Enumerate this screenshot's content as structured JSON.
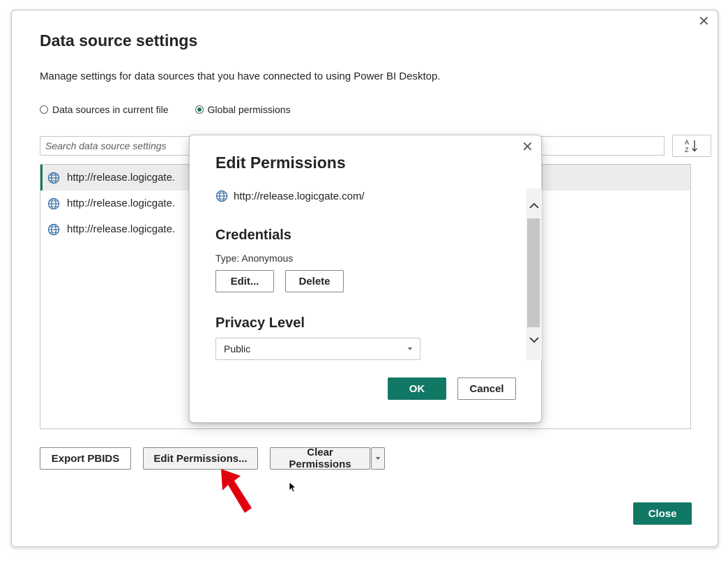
{
  "dialog": {
    "title": "Data source settings",
    "description": "Manage settings for data sources that you have connected to using Power BI Desktop.",
    "radio_options": [
      {
        "label": "Data sources in current file",
        "selected": false
      },
      {
        "label": "Global permissions",
        "selected": true
      }
    ],
    "search_placeholder": "Search data source settings",
    "sources": [
      {
        "url": "http://release.logicgate."
      },
      {
        "url": "http://release.logicgate."
      },
      {
        "url": "http://release.logicgate."
      }
    ],
    "buttons": {
      "export": "Export PBIDS",
      "edit_permissions": "Edit Permissions...",
      "clear_permissions": "Clear Permissions",
      "close": "Close"
    }
  },
  "modal": {
    "title": "Edit Permissions",
    "url": "http://release.logicgate.com/",
    "credentials_heading": "Credentials",
    "credential_type": "Type: Anonymous",
    "edit_button": "Edit...",
    "delete_button": "Delete",
    "privacy_heading": "Privacy Level",
    "privacy_value": "Public",
    "ok_button": "OK",
    "cancel_button": "Cancel"
  },
  "colors": {
    "accent": "#117865",
    "annotation_arrow": "#e0000f"
  },
  "icons": [
    "close-icon",
    "sort-az-icon",
    "globe-icon",
    "chevron-up-icon",
    "chevron-down-icon",
    "dropdown-arrow-icon",
    "mouse-cursor-icon"
  ]
}
